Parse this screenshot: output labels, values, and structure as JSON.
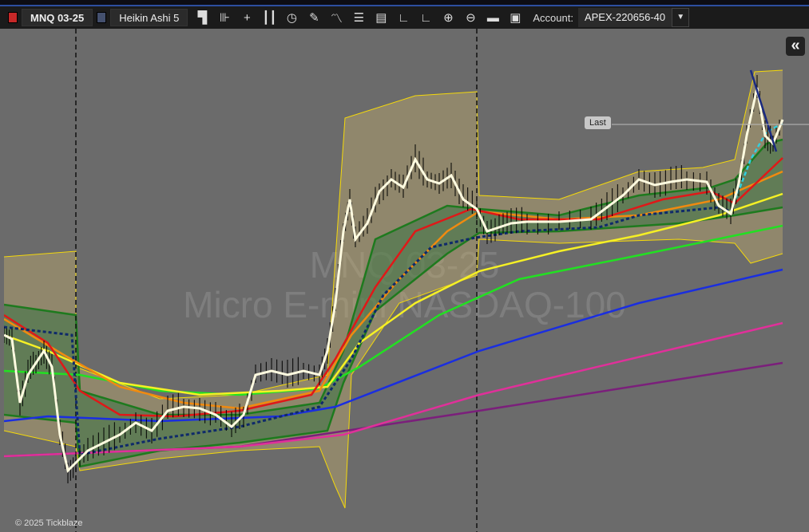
{
  "toolbar": {
    "symbol": "MNQ 03-25",
    "symbol_color": "#c62828",
    "timeframe": "Heikin Ashi 5",
    "timeframe_color": "#44506e",
    "icons": [
      "layout-icon",
      "chart-scale-icon",
      "crosshair-icon",
      "candlestick-icon",
      "clock-icon",
      "pencil-icon",
      "indicator-icon",
      "list-icon",
      "report-icon",
      "axis-icon",
      "axis-alt-icon",
      "zoom-in-icon",
      "zoom-out-icon",
      "folder-icon",
      "save-icon"
    ],
    "account_label": "Account:",
    "account_value": "APEX-220656-40"
  },
  "chart": {
    "watermark_symbol": "MNQ 03-25",
    "watermark_name": "Micro E-mini NASDAQ-100",
    "last_label": "Last",
    "copyright": "© 2025 Tickblaze",
    "colors": {
      "background": "#6b6b6b",
      "band": "#ffeb3b"
    }
  }
}
